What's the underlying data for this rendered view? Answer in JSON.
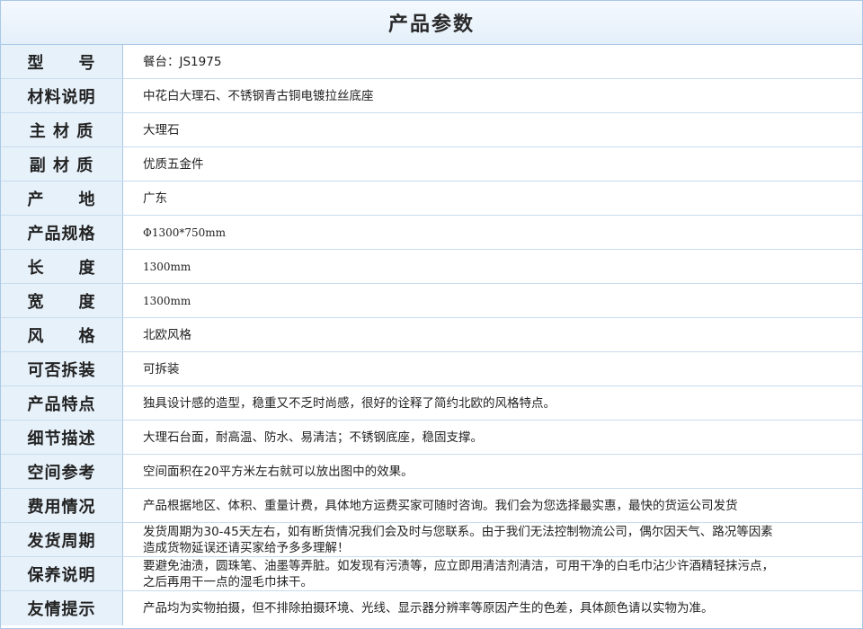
{
  "title": "产品参数",
  "rows": [
    {
      "label": "型　　号",
      "value": "餐台：JS1975"
    },
    {
      "label": "材料说明",
      "value": "中花白大理石、不锈钢青古铜电镀拉丝底座"
    },
    {
      "label": "主 材 质",
      "value": "大理石"
    },
    {
      "label": "副 材 质",
      "value": "优质五金件"
    },
    {
      "label": "产　　地",
      "value": "广东"
    },
    {
      "label": "产品规格",
      "value": "Φ1300*750mm"
    },
    {
      "label": "长　　度",
      "value": "1300mm"
    },
    {
      "label": "宽　　度",
      "value": "1300mm"
    },
    {
      "label": "风　　格",
      "value": "北欧风格"
    },
    {
      "label": "可否拆装",
      "value": "可拆装"
    },
    {
      "label": "产品特点",
      "value": "独具设计感的造型，稳重又不乏时尚感，很好的诠释了简约北欧的风格特点。"
    },
    {
      "label": "细节描述",
      "value": "大理石台面，耐高温、防水、易清洁；不锈钢底座，稳固支撑。"
    },
    {
      "label": "空间参考",
      "value": "空间面积在20平方米左右就可以放出图中的效果。"
    },
    {
      "label": "费用情况",
      "value": "产品根据地区、体积、重量计费，具体地方运费买家可随时咨询。我们会为您选择最实惠，最快的货运公司发货"
    },
    {
      "label": "发货周期",
      "value": "发货周期为30-45天左右，如有断货情况我们会及时与您联系。由于我们无法控制物流公司，偶尔因天气、路况等因素\n造成货物延误还请买家给予多多理解！"
    },
    {
      "label": "保养说明",
      "value": "要避免油渍，圆珠笔、油墨等弄脏。如发现有污渍等，应立即用清洁剂清洁，可用干净的白毛巾沾少许酒精轻抹污点，\n之后再用干一点的湿毛巾抹干。"
    },
    {
      "label": "友情提示",
      "value": "产品均为实物拍摄，但不排除拍摄环境、光线、显示器分辨率等原因产生的色差，具体颜色请以实物为准。"
    }
  ]
}
